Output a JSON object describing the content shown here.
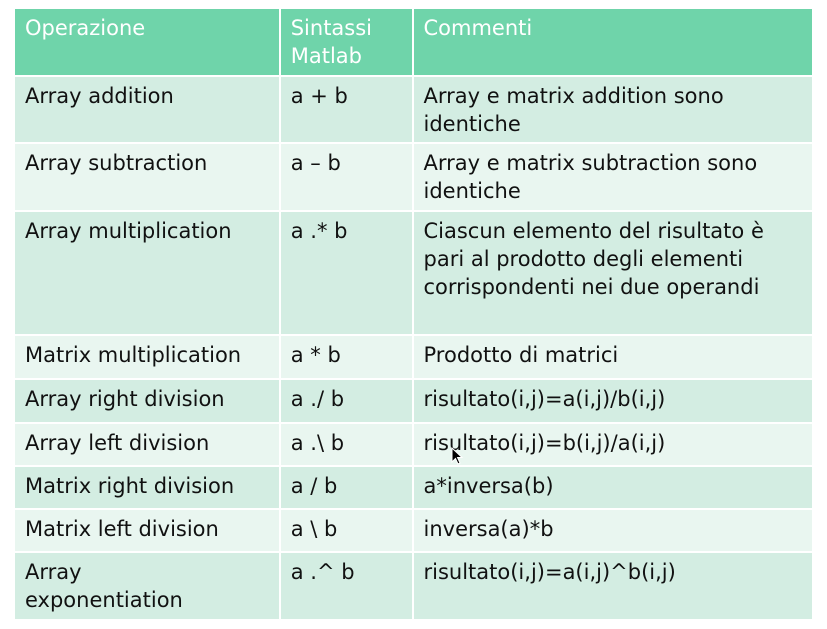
{
  "table": {
    "headers": [
      "Operazione",
      "Sintassi Matlab",
      "Commenti"
    ],
    "rows": [
      {
        "operation": "Array addition",
        "syntax": "a + b",
        "comment": "Array e matrix addition sono identiche"
      },
      {
        "operation": "Array subtraction",
        "syntax": "a – b",
        "comment": "Array e matrix subtraction sono identiche"
      },
      {
        "operation": "Array multiplication",
        "syntax": "a .* b",
        "comment": "Ciascun elemento del risultato è pari al prodotto degli elementi corrispondenti nei due operandi"
      },
      {
        "operation": "Matrix multiplication",
        "syntax": "a * b",
        "comment": "Prodotto di matrici"
      },
      {
        "operation": "Array right division",
        "syntax": "a ./ b",
        "comment": "risultato(i,j)=a(i,j)/b(i,j)"
      },
      {
        "operation": "Array left division",
        "syntax": "a .\\ b",
        "comment": "risultato(i,j)=b(i,j)/a(i,j)"
      },
      {
        "operation": "Matrix right division",
        "syntax": "a / b",
        "comment": "a*inversa(b)"
      },
      {
        "operation": "Matrix left division",
        "syntax": "a \\ b",
        "comment": "inversa(a)*b"
      },
      {
        "operation": "Array exponentiation",
        "syntax": "a .^ b",
        "comment": "risultato(i,j)=a(i,j)^b(i,j)"
      }
    ]
  },
  "colors": {
    "header_bg": "#6fd4aa",
    "row_odd_bg": "#d3ede2",
    "row_even_bg": "#e9f6f0",
    "header_text": "#ffffff"
  },
  "cursor": {
    "icon": "mouse-pointer-icon"
  }
}
